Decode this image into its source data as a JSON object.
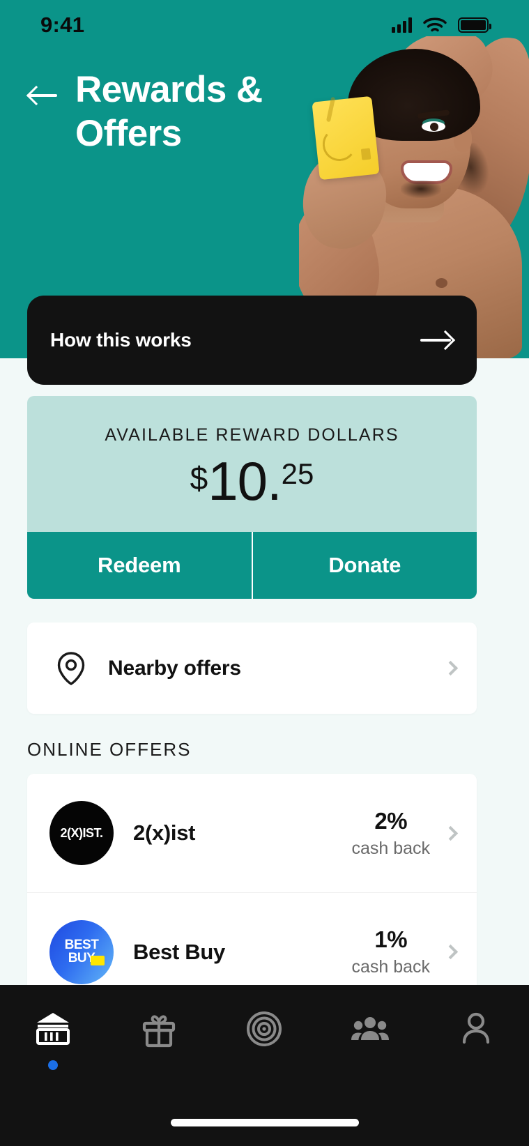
{
  "status_bar": {
    "time": "9:41",
    "signal_icon": "cellular-signal-icon",
    "wifi_icon": "wifi-icon",
    "battery_icon": "battery-icon"
  },
  "header": {
    "back_icon": "back-arrow-icon",
    "title": "Rewards & Offers",
    "hero_alt": "hero-photo"
  },
  "how_it_works": {
    "label": "How this works",
    "arrow_icon": "arrow-right-icon"
  },
  "reward": {
    "label": "AVAILABLE REWARD DOLLARS",
    "currency": "$",
    "whole": "10.",
    "cents": "25",
    "redeem_label": "Redeem",
    "donate_label": "Donate"
  },
  "nearby": {
    "icon": "location-pin-icon",
    "label": "Nearby offers",
    "chevron_icon": "chevron-right-icon"
  },
  "online_offers": {
    "section_title": "ONLINE OFFERS",
    "sub_label": "cash back",
    "items": [
      {
        "name": "2(x)ist",
        "logo_text": "2(X)IST.",
        "percent": "2%",
        "sub": "cash back"
      },
      {
        "name": "Best Buy",
        "logo_line1": "BEST",
        "logo_line2": "BUY",
        "percent": "1%",
        "sub": "cash back"
      }
    ]
  },
  "tabbar": {
    "items": [
      {
        "name": "bank-tab",
        "icon": "bank-icon",
        "active": true
      },
      {
        "name": "gift-tab",
        "icon": "gift-icon",
        "active": false
      },
      {
        "name": "target-tab",
        "icon": "target-icon",
        "active": false
      },
      {
        "name": "people-tab",
        "icon": "people-icon",
        "active": false
      },
      {
        "name": "profile-tab",
        "icon": "person-icon",
        "active": false
      }
    ]
  },
  "colors": {
    "teal": "#0B9489",
    "mint_card": "#BCE0DB",
    "page_bg": "#F2F9F8",
    "dark": "#121212",
    "accent_blue": "#1B6FE6",
    "card_yellow": "#F5CE2A"
  }
}
